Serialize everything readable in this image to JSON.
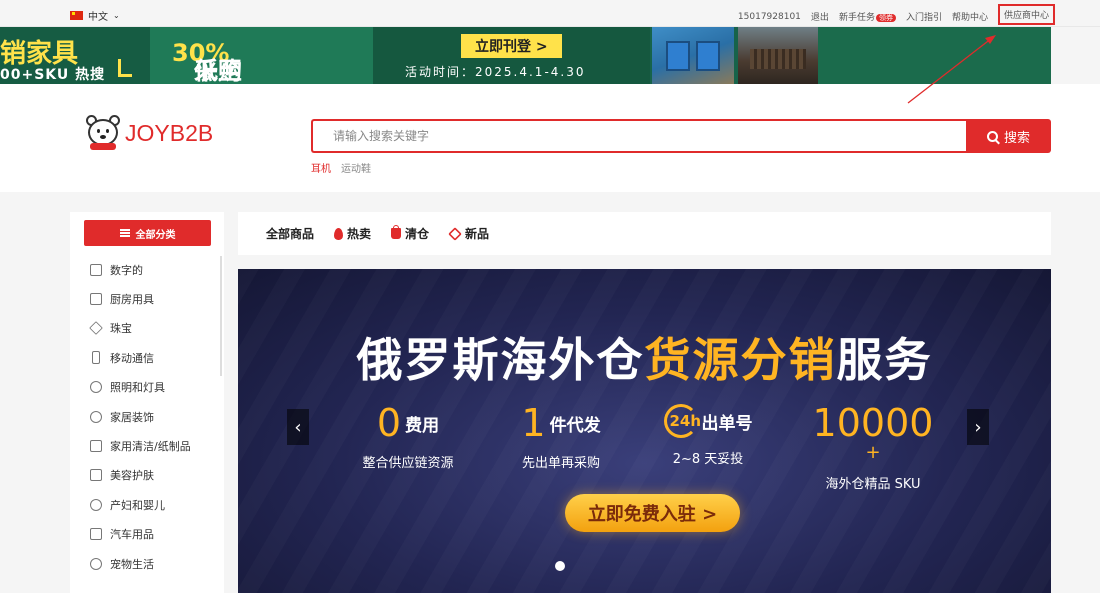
{
  "topbar": {
    "language": "中文",
    "links": {
      "phone": "15017928101",
      "logout": "退出",
      "newbie_tasks": "新手任务",
      "newbie_badge": "领券",
      "getting_started": "入门指引",
      "help_center": "帮助中心",
      "supplier_center": "供应商中心"
    }
  },
  "promo": {
    "left_title": "销家具",
    "left_sub": "00+SKU 热搜",
    "discount_prefix": "低至 ",
    "discount_value": "30%",
    "discount_suffix": "采购",
    "cta": "立即刊登 >",
    "period": "活动时间：2025.4.1-4.30"
  },
  "header": {
    "logo_text": "JOYB2B",
    "search_placeholder": "请输入搜索关键字",
    "search_button": "搜索",
    "hot_words": [
      "耳机",
      "运动鞋"
    ]
  },
  "sidebar": {
    "all_categories": "全部分类",
    "items": [
      {
        "label": "数字的",
        "icon": "camera-icon"
      },
      {
        "label": "厨房用具",
        "icon": "stove-icon"
      },
      {
        "label": "珠宝",
        "icon": "diamond-icon"
      },
      {
        "label": "移动通信",
        "icon": "phone-icon"
      },
      {
        "label": "照明和灯具",
        "icon": "lamp-icon"
      },
      {
        "label": "家居装饰",
        "icon": "flower-icon"
      },
      {
        "label": "家用清洁/纸制品",
        "icon": "tissue-icon"
      },
      {
        "label": "美容护肤",
        "icon": "cosmetics-icon"
      },
      {
        "label": "产妇和婴儿",
        "icon": "baby-icon"
      },
      {
        "label": "汽车用品",
        "icon": "car-icon"
      },
      {
        "label": "宠物生活",
        "icon": "pet-icon"
      }
    ]
  },
  "nav": {
    "tabs": [
      {
        "label": "全部商品",
        "icon": ""
      },
      {
        "label": "热卖",
        "icon": "flame-icon"
      },
      {
        "label": "清仓",
        "icon": "bag-icon"
      },
      {
        "label": "新品",
        "icon": "new-tag-icon"
      }
    ]
  },
  "hero": {
    "title_white_1": "俄罗斯海外仓",
    "title_orange": "货源分销",
    "title_white_2": "服务",
    "stats": [
      {
        "num": "0",
        "label": "费用",
        "sub": "整合供应链资源"
      },
      {
        "num": "1",
        "label": "件代发",
        "sub": "先出单再采购"
      },
      {
        "num": "24h",
        "label": "出单号",
        "sub": "2~8 天妥投"
      },
      {
        "num": "10000",
        "plus": "+",
        "label": "",
        "sub": "海外仓精品 SKU"
      }
    ],
    "cta": "立即免费入驻 >",
    "prev": "‹",
    "next": "›"
  },
  "colors": {
    "brand_red": "#e02b2b",
    "accent_orange": "#ffb422",
    "promo_green": "#17634a"
  }
}
